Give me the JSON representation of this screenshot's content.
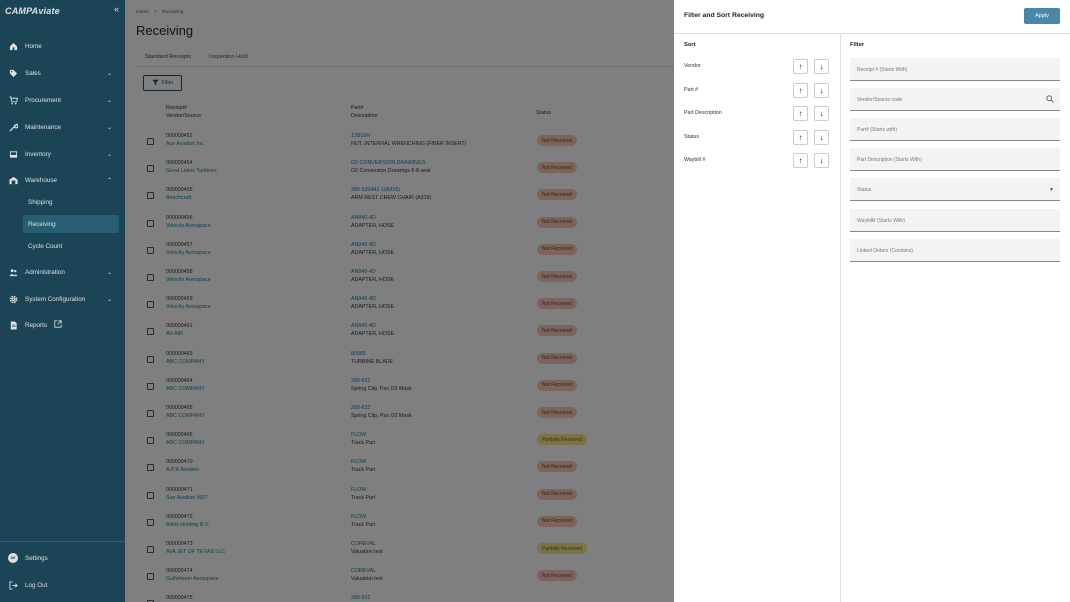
{
  "app": {
    "logo_text": "CAMPAviate"
  },
  "sidebar": {
    "items": [
      {
        "label": "Home",
        "icon": "home-icon"
      },
      {
        "label": "Sales",
        "icon": "tag-icon"
      },
      {
        "label": "Procurement",
        "icon": "cart-icon"
      },
      {
        "label": "Maintenance",
        "icon": "wrench-icon"
      },
      {
        "label": "Inventory",
        "icon": "inbox-icon"
      },
      {
        "label": "Warehouse",
        "icon": "warehouse-icon"
      },
      {
        "label": "Administration",
        "icon": "people-icon"
      },
      {
        "label": "System Configuration",
        "icon": "gear-icon"
      },
      {
        "label": "Reports",
        "icon": "document-icon"
      }
    ],
    "warehouse_sub": [
      "Shipping",
      "Receiving",
      "Cycle Count"
    ],
    "footer": {
      "avatar": "DE",
      "settings": "Settings",
      "logout": "Log Out"
    }
  },
  "main": {
    "breadcrumb_home": "Home",
    "breadcrumb_sep": ">",
    "breadcrumb_current": "Receiving",
    "title": "Receiving",
    "tabs": [
      "Standard Receipts",
      "Inspection Hold"
    ],
    "filter_label": "Filter",
    "columns": {
      "receipt": "Receipt#",
      "vendor": "Vendor/Source",
      "part": "Part#",
      "description": "Description",
      "status": "Status"
    },
    "rows": [
      {
        "receipt": "000000452",
        "vendor": "Ace Aviation Inc",
        "part": "12B10H",
        "desc": "NUT, INTERNAL WRENCHING (FIBER INSERT)",
        "status": "Not Received"
      },
      {
        "receipt": "000000454",
        "vendor": "Great Lakes Turbines",
        "part": "O2 CONVERSION DRAWINGS",
        "desc": "O2 Conversion Drawings 6-8 seat",
        "status": "Not Received"
      },
      {
        "receipt": "000000455",
        "vendor": "Beechcraft",
        "part": "380-530442-1(A316)",
        "desc": "ARM REST CREW CHAIR (A316)",
        "status": "Not Received"
      },
      {
        "receipt": "000000456",
        "vendor": "Velocity Aerospace",
        "part": "AN840-4D",
        "desc": "ADAPTER, HOSE",
        "status": "Not Received"
      },
      {
        "receipt": "000000457",
        "vendor": "Velocity Aerospace",
        "part": "AN840-4D",
        "desc": "ADAPTER, HOSE",
        "status": "Not Received"
      },
      {
        "receipt": "000000458",
        "vendor": "Velocity Aerospace",
        "part": "AN840-4D",
        "desc": "ADAPTER, HOSE",
        "status": "Not Received"
      },
      {
        "receipt": "000000459",
        "vendor": "Velocity Aerospace",
        "part": "AN840-4D",
        "desc": "ADAPTER, HOSE",
        "status": "Not Received"
      },
      {
        "receipt": "000000461",
        "vendor": "AV-AIR",
        "part": "AN840-4D",
        "desc": "ADAPTER, HOSE",
        "status": "Not Received"
      },
      {
        "receipt": "000000463",
        "vendor": "ABC COMPANY",
        "part": "80989",
        "desc": "TURBINE BLADE",
        "status": "Not Received"
      },
      {
        "receipt": "000000464",
        "vendor": "ABC COMPANY",
        "part": "289-632",
        "desc": "Spring Clip, Pax O2 Mask",
        "status": "Not Received"
      },
      {
        "receipt": "000000465",
        "vendor": "ABC COMPANY",
        "part": "289-632",
        "desc": "Spring Clip, Pax O2 Mask",
        "status": "Not Received"
      },
      {
        "receipt": "000000466",
        "vendor": "ABC COMPANY",
        "part": "FLOW",
        "desc": "Track Part",
        "status": "Partially Received"
      },
      {
        "receipt": "000000470",
        "vendor": "A.P.R Aviation",
        "part": "FLOW",
        "desc": "Track Part",
        "status": "Not Received"
      },
      {
        "receipt": "000000471",
        "vendor": "Sun Aviation NDT",
        "part": "FLOW",
        "desc": "Track Part",
        "status": "Not Received"
      },
      {
        "receipt": "000000472",
        "vendor": "Bikris Holding B.V.",
        "part": "FLOW",
        "desc": "Track Part",
        "status": "Not Received"
      },
      {
        "receipt": "000000473",
        "vendor": "AVA JET OF TEXAS LLC",
        "part": "COREVAL",
        "desc": "Valuation test",
        "status": "Partially Received"
      },
      {
        "receipt": "000000474",
        "vendor": "Gulfstream Aerospace",
        "part": "COREVAL",
        "desc": "Valuation test",
        "status": "Not Received"
      },
      {
        "receipt": "000000475",
        "vendor": "",
        "part": "289-632",
        "desc": "",
        "status": ""
      }
    ]
  },
  "panel": {
    "title": "Filter and Sort Receiving",
    "apply": "Apply",
    "sort_title": "Sort",
    "filter_title": "Filter",
    "sort_fields": [
      "Vendor",
      "Part #",
      "Part Description",
      "Status",
      "Waybill #"
    ],
    "filter_fields": [
      {
        "placeholder": "Receipt # (Starts With)",
        "icon": ""
      },
      {
        "placeholder": "Vendor/Source code",
        "icon": "search-icon"
      },
      {
        "placeholder": "Part# (Starts with)",
        "icon": ""
      },
      {
        "placeholder": "Part Description (Starts With)",
        "icon": ""
      },
      {
        "placeholder": "Status",
        "icon": "dropdown-arrow-icon"
      },
      {
        "placeholder": "Waybill# (Starts With)",
        "icon": ""
      },
      {
        "placeholder": "Linked Orders (Contains)",
        "icon": ""
      }
    ]
  },
  "colors": {
    "sidebar": "#1f4e63",
    "accent": "#4a86a8",
    "not_received": "#f7c9b8",
    "partially_received": "#f6e58d",
    "link": "#1a7a9c"
  }
}
